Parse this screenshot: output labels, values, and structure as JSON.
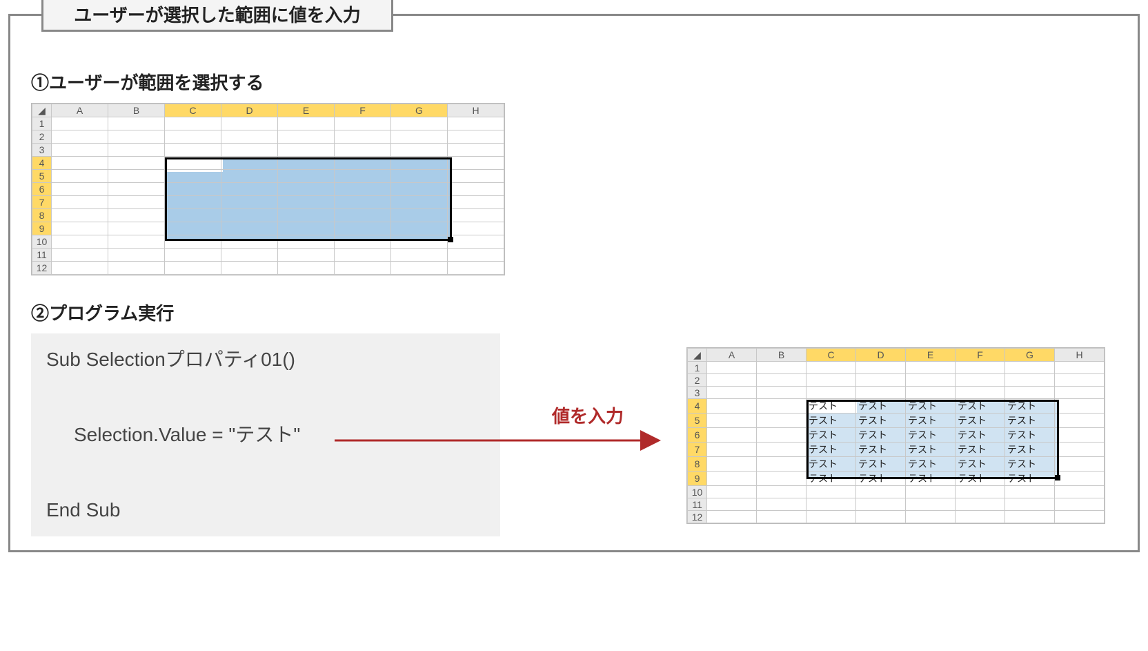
{
  "title": "ユーザーが選択した範囲に値を入力",
  "section1": "①ユーザーが範囲を選択する",
  "section2": "②プログラム実行",
  "code": {
    "line1": "Sub Selectionプロパティ01()",
    "line2": "Selection.Value = \"テスト\"",
    "line3": "End Sub"
  },
  "arrow_label": "値を入力",
  "grid": {
    "columns": [
      "A",
      "B",
      "C",
      "D",
      "E",
      "F",
      "G",
      "H"
    ],
    "rows": [
      "1",
      "2",
      "3",
      "4",
      "5",
      "6",
      "7",
      "8",
      "9",
      "10",
      "11",
      "12"
    ],
    "selected_cols": [
      "C",
      "D",
      "E",
      "F",
      "G"
    ],
    "selected_rows": [
      "4",
      "5",
      "6",
      "7",
      "8",
      "9"
    ],
    "fill_value": "テスト"
  }
}
